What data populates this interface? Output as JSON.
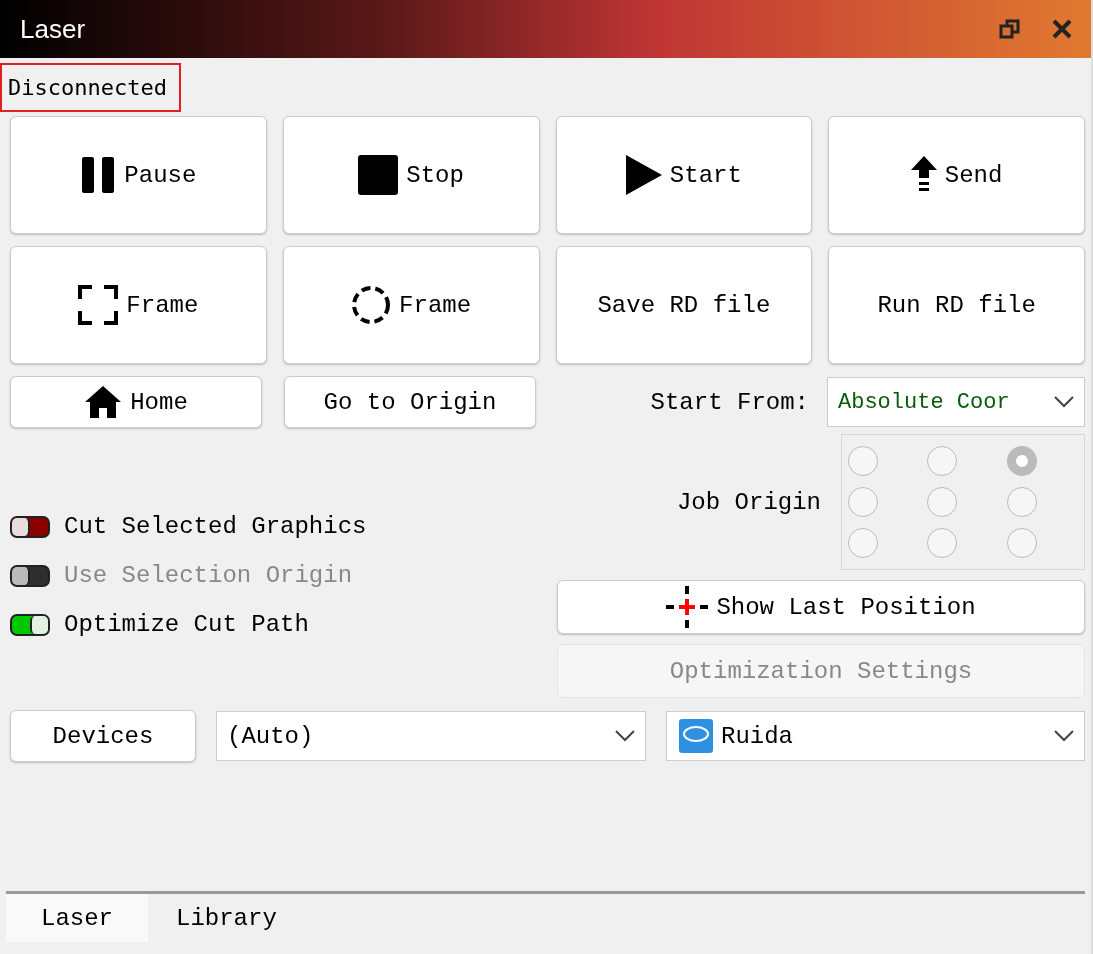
{
  "window": {
    "title": "Laser"
  },
  "status": {
    "text": "Disconnected",
    "highlighted": true
  },
  "big_buttons": [
    {
      "label": "Pause",
      "kind": "pause"
    },
    {
      "label": "Stop",
      "kind": "stop"
    },
    {
      "label": "Start",
      "kind": "play"
    },
    {
      "label": "Send",
      "kind": "send"
    },
    {
      "label": "Frame",
      "kind": "frame-rect"
    },
    {
      "label": "Frame",
      "kind": "frame-circle"
    },
    {
      "label": "Save RD file",
      "kind": "none"
    },
    {
      "label": "Run RD file",
      "kind": "none"
    }
  ],
  "small_buttons": [
    {
      "label": "Home",
      "kind": "home"
    },
    {
      "label": "Go to Origin",
      "kind": "none"
    }
  ],
  "start_from": {
    "label": "Start From:",
    "value": "Absolute Coor"
  },
  "job_origin": {
    "label": "Job Origin",
    "options": [
      {
        "selected": false
      },
      {
        "selected": false
      },
      {
        "selected": true
      },
      {
        "selected": false
      },
      {
        "selected": false
      },
      {
        "selected": false
      },
      {
        "selected": false
      },
      {
        "selected": false
      },
      {
        "selected": false
      }
    ]
  },
  "toggles": [
    {
      "label": "Cut Selected Graphics",
      "on": false,
      "disabled": false,
      "color": "#8b0000"
    },
    {
      "label": "Use Selection Origin",
      "on": false,
      "disabled": true,
      "color": "#2e2e2e"
    },
    {
      "label": "Optimize Cut Path",
      "on": true,
      "disabled": false,
      "color": "#00c800"
    }
  ],
  "show_last_position": {
    "label": "Show Last Position"
  },
  "optimization_settings": {
    "label": "Optimization Settings",
    "disabled": true
  },
  "devices": {
    "button": "Devices",
    "port": "(Auto)",
    "controller": "Ruida"
  },
  "tabs": [
    {
      "label": "Laser",
      "selected": true
    },
    {
      "label": "Library",
      "selected": false
    }
  ]
}
